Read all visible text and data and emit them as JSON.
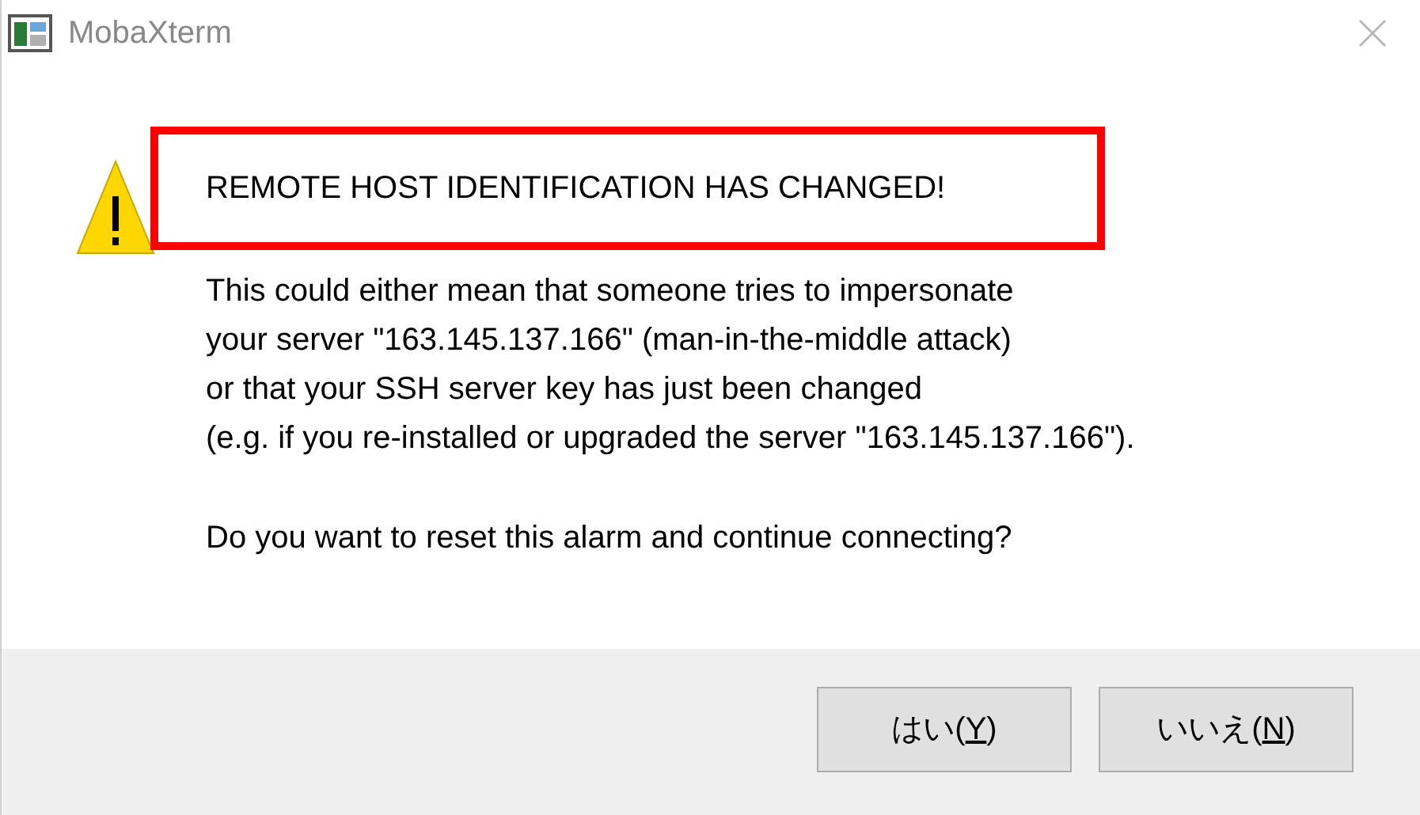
{
  "window": {
    "title": "MobaXterm"
  },
  "heading": "REMOTE HOST IDENTIFICATION HAS CHANGED!",
  "message_lines": [
    "This could either mean that someone tries to impersonate",
    "your server \"163.145.137.166\" (man-in-the-middle attack)",
    "or that your SSH server key has just been changed",
    "(e.g. if you re-installed or upgraded the server \"163.145.137.166\")."
  ],
  "question": "Do you want to reset this alarm and continue connecting?",
  "buttons": [
    {
      "label": "はい(Y)"
    },
    {
      "label": "いいえ(N)"
    }
  ]
}
